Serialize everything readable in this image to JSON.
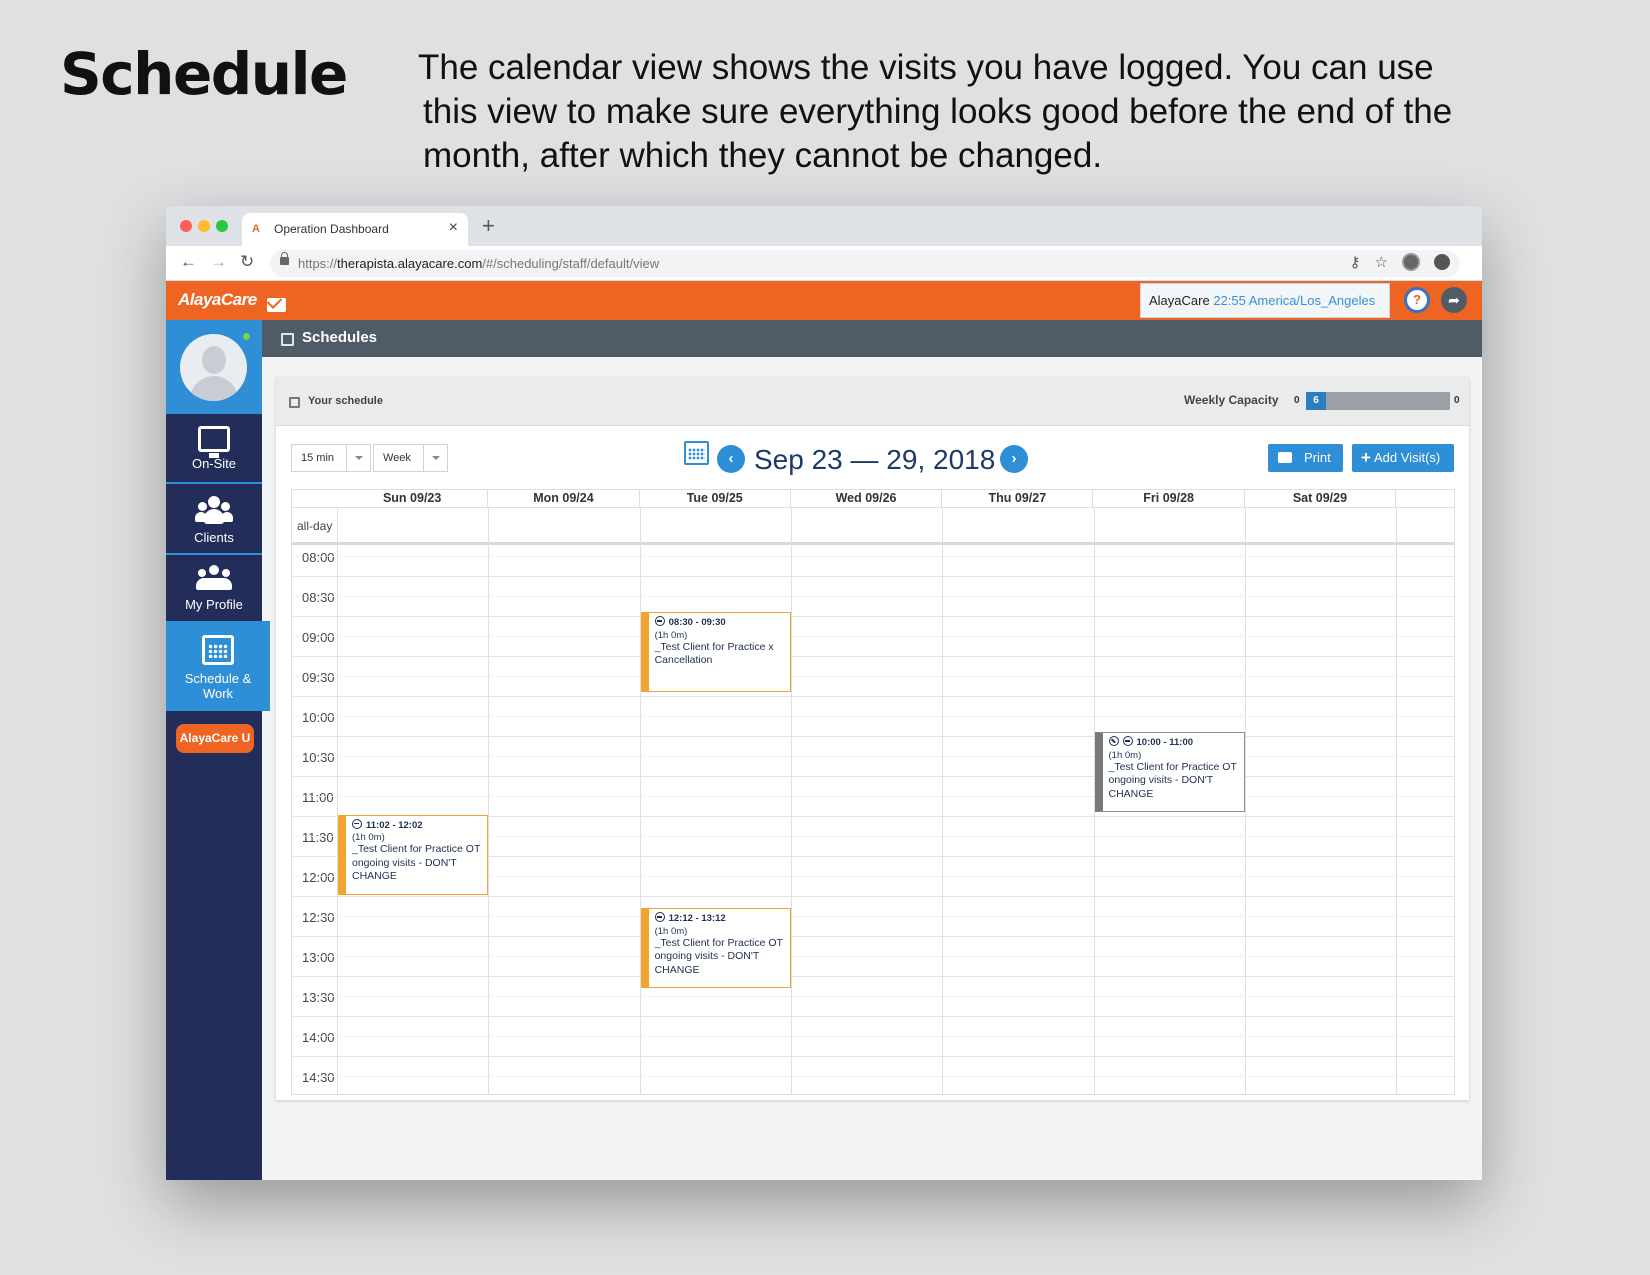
{
  "intro": {
    "title": "Schedule",
    "desc_lines": [
      "The calendar view shows the visits you have logged. You can use",
      "this view to make sure everything looks good before the end of the",
      "month, after which they cannot be changed."
    ]
  },
  "browser": {
    "tab_title": "Operation Dashboard",
    "url_prefix": "https://",
    "url_host": "therapista.alayacare.com",
    "url_path": "/#/scheduling/staff/default/view"
  },
  "header": {
    "logo": "AlayaCare",
    "org": "AlayaCare",
    "time": "22:55 America/Los_Angeles"
  },
  "sidebar": {
    "items": [
      {
        "label": "On-Site"
      },
      {
        "label": "Clients"
      },
      {
        "label": "My Profile"
      },
      {
        "label": "Schedule & Work"
      }
    ],
    "university_button": "AlayaCare U"
  },
  "subheader": {
    "title": "Schedules"
  },
  "panel": {
    "title": "Your schedule",
    "capacity_label": "Weekly Capacity",
    "capacity_min": "0",
    "capacity_value": "6",
    "capacity_max": "0",
    "capacity_fill_fraction": 0.14
  },
  "controls": {
    "interval": "15 min",
    "view": "Week",
    "date_range": "Sep 23 — 29, 2018",
    "print_label": "Print",
    "add_label": "Add Visit(s)"
  },
  "calendar": {
    "allday_label": "all-day",
    "days": [
      "Sun 09/23",
      "Mon 09/24",
      "Tue 09/25",
      "Wed 09/26",
      "Thu 09/27",
      "Fri 09/28",
      "Sat 09/29"
    ],
    "time_slots": [
      "08:00",
      "08:30",
      "09:00",
      "09:30",
      "10:00",
      "10:30",
      "11:00",
      "11:30",
      "12:00",
      "12:30",
      "13:00",
      "13:30",
      "14:00",
      "14:30"
    ],
    "events": [
      {
        "day": 2,
        "start": "08:30",
        "end": "09:30",
        "time": "08:30 - 09:30",
        "duration": "(1h 0m)",
        "title": "_Test Client for Practice x Cancellation",
        "status": "orange",
        "icons": [
          "clock"
        ]
      },
      {
        "day": 5,
        "start": "10:00",
        "end": "11:00",
        "time": "10:00 - 11:00",
        "duration": "(1h 0m)",
        "title": "_Test Client for Practice OT ongoing visits - DON'T CHANGE",
        "status": "grey",
        "icons": [
          "no",
          "clock"
        ]
      },
      {
        "day": 0,
        "start": "11:02",
        "end": "12:02",
        "time": "11:02 - 12:02",
        "duration": "(1h 0m)",
        "title": "_Test Client for Practice OT ongoing visits - DON'T CHANGE",
        "status": "orange",
        "icons": [
          "clock"
        ]
      },
      {
        "day": 2,
        "start": "12:12",
        "end": "13:12",
        "time": "12:12 - 13:12",
        "duration": "(1h 0m)",
        "title": "_Test Client for Practice OT ongoing visits - DON'T CHANGE",
        "status": "orange",
        "icons": [
          "clock"
        ]
      }
    ]
  },
  "colors": {
    "brand_orange": "#ed6423",
    "sidebar_navy": "#222d59",
    "accent_blue": "#2e8ed6",
    "event_orange": "#f2a431",
    "event_grey": "#77797c"
  }
}
